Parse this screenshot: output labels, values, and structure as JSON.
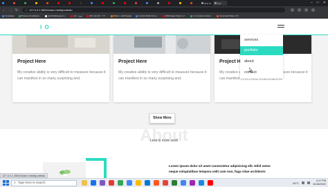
{
  "browser": {
    "tabs": [
      {
        "label": "",
        "color": "#4285f4"
      },
      {
        "label": "",
        "color": "#ea4335"
      },
      {
        "label": "",
        "color": "#34a853"
      },
      {
        "label": "",
        "color": "#fbbc05"
      },
      {
        "label": "",
        "color": "#ea4335"
      },
      {
        "label": "",
        "color": "#ff0000"
      },
      {
        "label": "",
        "color": "#ff0000"
      },
      {
        "label": "",
        "color": "#333333"
      },
      {
        "label": "",
        "color": "#4285f4"
      },
      {
        "label": "",
        "color": "#ff0000"
      },
      {
        "label": "",
        "color": "#34a853"
      },
      {
        "label": "",
        "color": "#ff0000"
      },
      {
        "label": "",
        "color": "#ea4335"
      },
      {
        "label": "",
        "color": "#4285f4"
      },
      {
        "label": "",
        "color": "#9aa0a6"
      },
      {
        "label": "",
        "color": "#ff0000"
      },
      {
        "label": "",
        "color": "#fbbc05"
      },
      {
        "label": "",
        "color": "#ea4335"
      },
      {
        "label": "New Ta",
        "color": "#9aa0a6"
      },
      {
        "label": "Icon",
        "color": "#9aa0a6",
        "active": true
      }
    ],
    "url": "127.0.0.1:5500/index.html#portfolio",
    "bookmarks": [
      {
        "label": "Templates",
        "color": "#4285f4"
      },
      {
        "label": "Browse all software...",
        "color": "#34a853"
      },
      {
        "label": "devChallenges.io |...",
        "color": "#ffffff"
      },
      {
        "label": "دورة ...(1)",
        "color": "#ff0000"
      },
      {
        "label": "(81) Lila 3D - Y.T...",
        "color": "#ff0000"
      },
      {
        "label": "Bolton - Add Design",
        "color": "#ff6d00"
      },
      {
        "label": "Formik: Build forms...",
        "color": "#4285f4"
      },
      {
        "label": "[TED] Easy Way to V...",
        "color": "#ff0000"
      },
      {
        "label": "A Complete Guide t...",
        "color": "#34a853"
      },
      {
        "label": "Download Brave | B...",
        "color": "#fb542b"
      }
    ]
  },
  "site": {
    "logo": "I O",
    "accent": "#2bdbc1",
    "cards": [
      {
        "title": "Project Here",
        "text": "My creative ability is very difficult to measure because it can manifest in so many surprising and."
      },
      {
        "title": "Project Here",
        "text": "My creative ability is very difficult to measure because it can manifest in so many surprising and."
      },
      {
        "title": "Project Here",
        "text": "My creative ability is very difficult to measure because it can manifest in so many surprising and."
      }
    ],
    "show_more": "Show More",
    "about_title": "About",
    "about_subtitle": "Less is more work",
    "about_paragraph": "Lorem ipsum dolor sit amet consectetur adipisicing elit. Nihil nemo neque voluptatibus tempora velit cum non, fuga vitae architecto",
    "menu": [
      {
        "label": "services"
      },
      {
        "label": "portfolio",
        "active": true
      },
      {
        "label": "about"
      },
      {
        "label": "contact"
      }
    ]
  },
  "status": {
    "text": "127.0.0.1:5500/index.html#portfolio"
  },
  "taskbar": {
    "search_placeholder": "Type here to search",
    "apps": [
      "#f0c14b",
      "#1a73e8",
      "#7e57c2",
      "#e53935",
      "#34a853",
      "#4285f4",
      "#fbbc05",
      "#0078d4",
      "#ff5722",
      "#ea4335",
      "#2e7d32",
      "#4285f4",
      "#9c27b0",
      "#1e88e5",
      "#ff0000"
    ],
    "weather": "26°C",
    "time": "4:17 PM",
    "date": "10/18/2022"
  }
}
